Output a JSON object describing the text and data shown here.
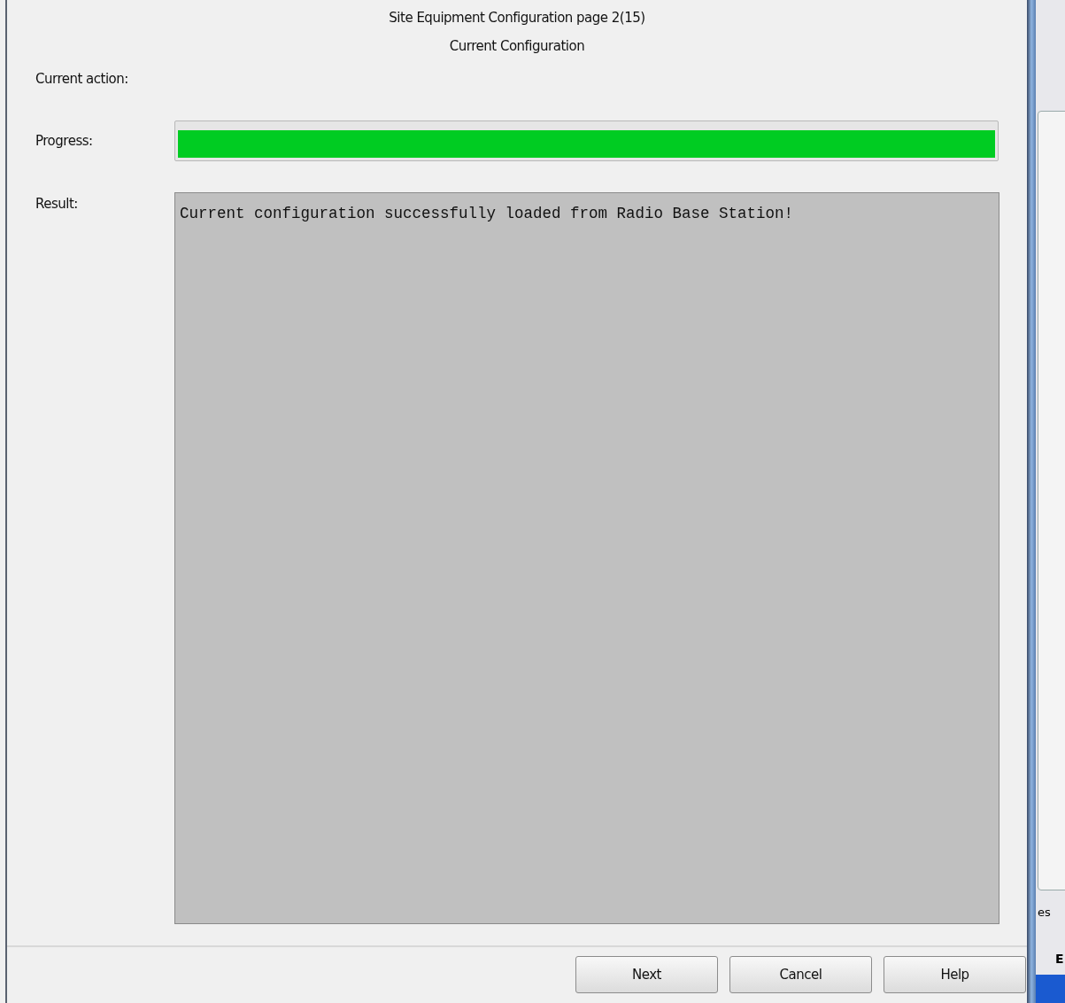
{
  "dialog": {
    "title": "Site Equipment Configuration page 2(15)",
    "subtitle": "Current Configuration",
    "current_action": {
      "label": "Current action:"
    },
    "progress": {
      "label": "Progress:",
      "level": 1
    },
    "result": {
      "label": "Result:",
      "text": "Current configuration successfully loaded from Radio Base Station!"
    },
    "buttons": [
      {
        "label": "Next"
      },
      {
        "label": "Cancel"
      },
      {
        "label": "Help"
      }
    ]
  },
  "background_window": {
    "fragments": [
      "es",
      "E"
    ]
  }
}
